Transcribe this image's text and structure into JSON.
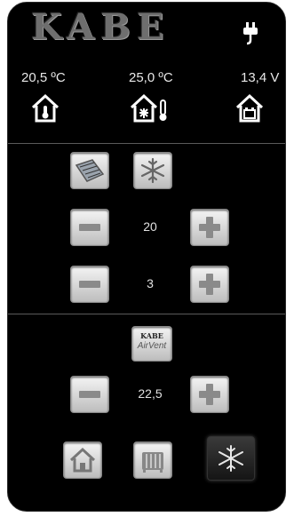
{
  "header": {
    "logo": "KABE"
  },
  "readouts": [
    {
      "label": "20,5 ºC",
      "icon": "house-thermometer-icon"
    },
    {
      "label": "25,0 ºC",
      "icon": "house-snowflake-thermometer-icon"
    },
    {
      "label": "13,4 V",
      "icon": "house-battery-icon"
    }
  ],
  "section_top": {
    "settings": [
      {
        "value": "20"
      },
      {
        "value": "3"
      }
    ]
  },
  "section_airvent": {
    "brand_logo": "KABE",
    "brand_sub": "AirVent",
    "setting": {
      "value": "22,5"
    }
  },
  "bottom_tabs": [
    "home-icon",
    "heater-icon",
    "snowflake-icon"
  ],
  "colors": {
    "background": "#000000",
    "text": "#e8e8e8",
    "button": "#d9d9d9"
  }
}
